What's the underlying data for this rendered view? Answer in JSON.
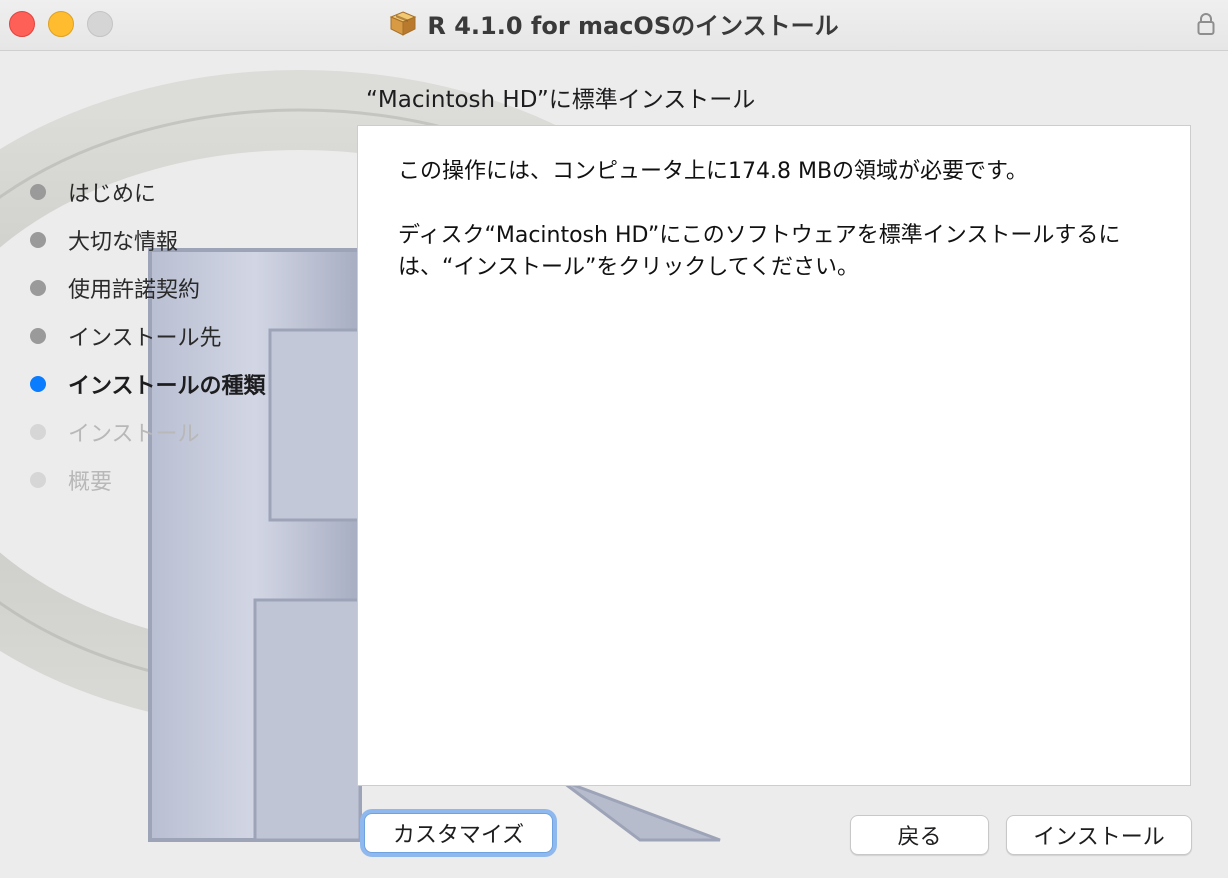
{
  "window": {
    "title": "R 4.1.0 for macOSのインストール",
    "title_icon": "package-icon",
    "lock_icon": "lock-icon"
  },
  "sidebar": {
    "steps": [
      {
        "label": "はじめに",
        "state": "done"
      },
      {
        "label": "大切な情報",
        "state": "done"
      },
      {
        "label": "使用許諾契約",
        "state": "done"
      },
      {
        "label": "インストール先",
        "state": "done"
      },
      {
        "label": "インストールの種類",
        "state": "active"
      },
      {
        "label": "インストール",
        "state": "pending"
      },
      {
        "label": "概要",
        "state": "pending"
      }
    ]
  },
  "main": {
    "header": "“Macintosh HD”に標準インストール",
    "paragraph1": "この操作には、コンピュータ上に174.8 MBの領域が必要です。",
    "paragraph2": "ディスク“Macintosh HD”にこのソフトウェアを標準インストールするには、“インストール”をクリックしてください。"
  },
  "buttons": {
    "customize": "カスタマイズ",
    "back": "戻る",
    "install": "インストール"
  },
  "colors": {
    "accent": "#0a7cff",
    "close": "#fe5f57",
    "minimize": "#febc2e"
  }
}
